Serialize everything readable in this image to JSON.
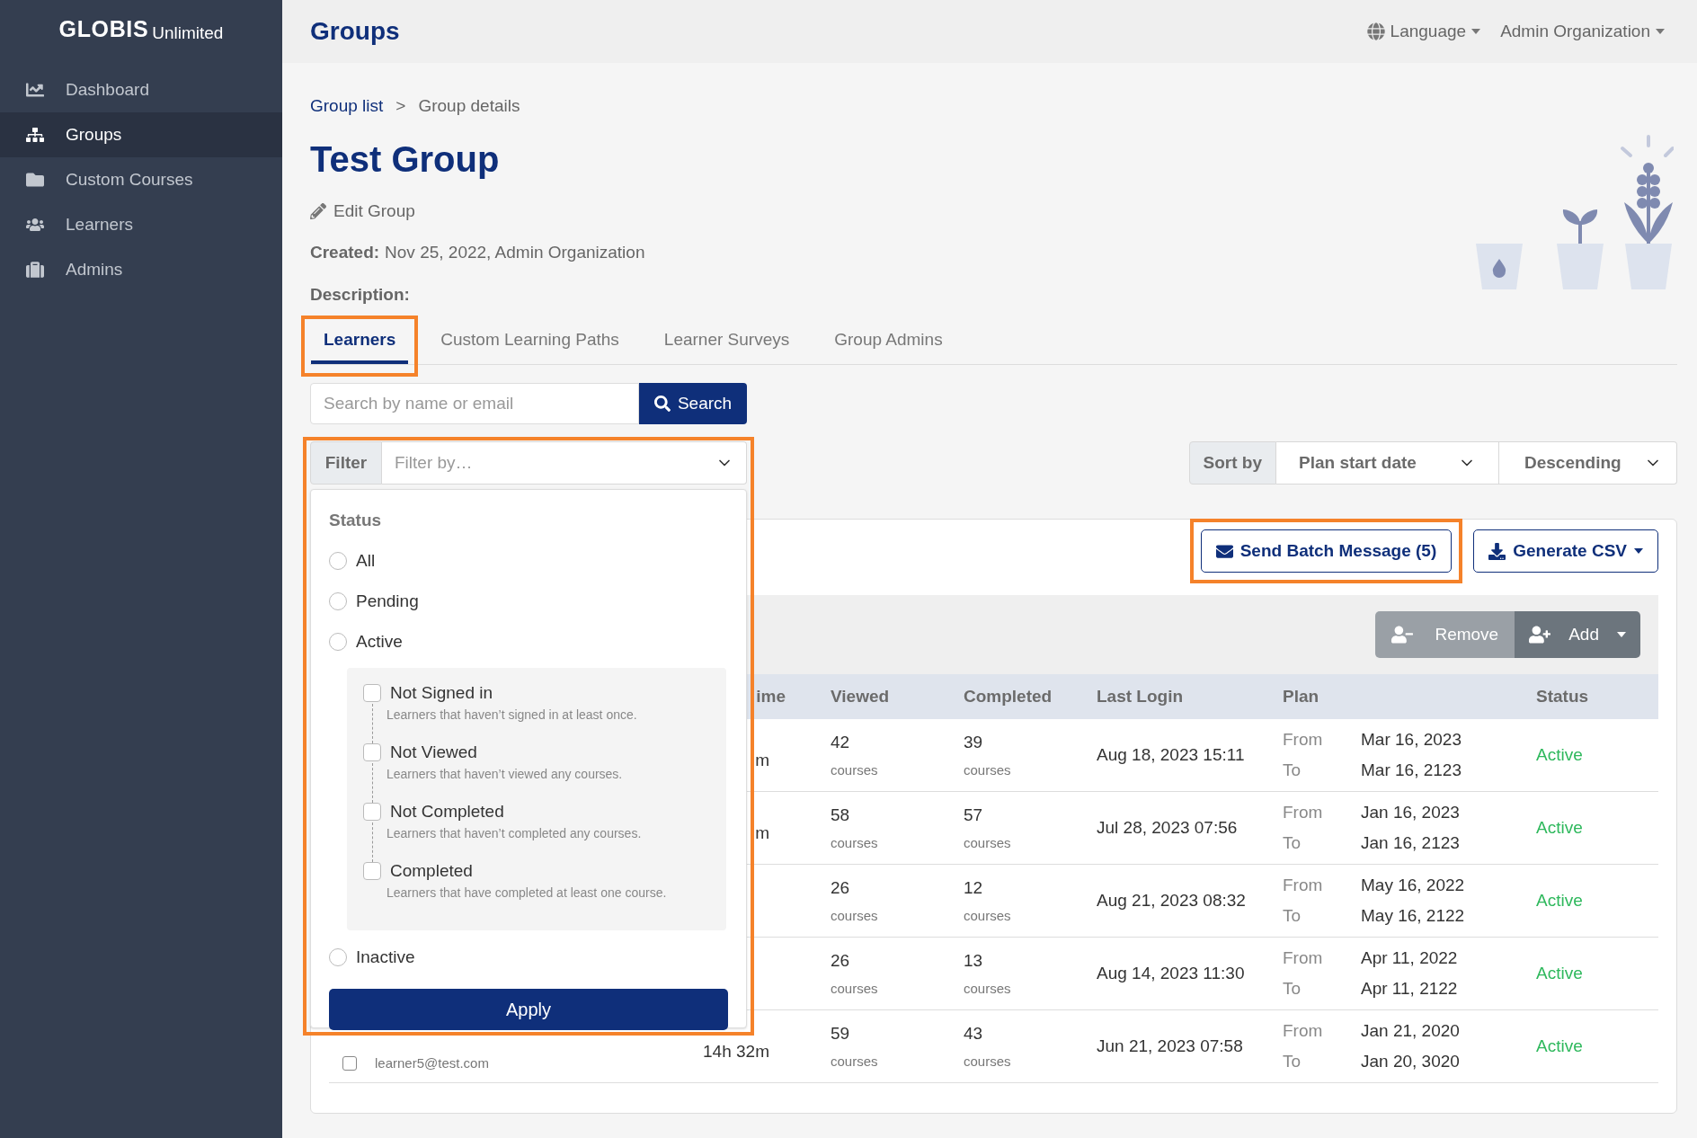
{
  "sidebar": {
    "logo": {
      "brand": "GLOBIS",
      "product": "Unlimited"
    },
    "items": [
      {
        "label": "Dashboard",
        "kind": "chart",
        "selected": false
      },
      {
        "label": "Groups",
        "kind": "groups",
        "selected": true
      },
      {
        "label": "Custom Courses",
        "kind": "folder",
        "selected": false
      },
      {
        "label": "Learners",
        "kind": "people",
        "selected": false
      },
      {
        "label": "Admins",
        "kind": "case",
        "selected": false
      }
    ]
  },
  "header": {
    "title": "Groups",
    "language": "Language",
    "account": "Admin Organization"
  },
  "breadcrumb": [
    {
      "label": "Group list",
      "kind": "link"
    },
    {
      "label": ">",
      "kind": "separator"
    },
    {
      "label": "Group details",
      "kind": "current"
    }
  ],
  "group": {
    "title": "Test Group",
    "edit": "Edit Group",
    "created_label": "Created:",
    "created_value": "Nov 25, 2022, Admin Organization",
    "description_label": "Description:"
  },
  "tabs": [
    {
      "label": "Learners",
      "selected": true,
      "highlighted": true
    },
    {
      "label": "Custom Learning Paths",
      "selected": false,
      "highlighted": false
    },
    {
      "label": "Learner Surveys",
      "selected": false,
      "highlighted": false
    },
    {
      "label": "Group Admins",
      "selected": false,
      "highlighted": false
    }
  ],
  "search": {
    "placeholder": "Search by name or email",
    "button": "Search"
  },
  "filter": {
    "label": "Filter",
    "placeholder": "Filter by…",
    "highlighted": true,
    "menu": {
      "heading": "Status",
      "apply": "Apply",
      "options": [
        {
          "label": "All",
          "selected": false
        },
        {
          "label": "Pending",
          "selected": false
        },
        {
          "label": "Active",
          "selected": false,
          "children": [
            {
              "label": "Not Signed in",
              "description": "Learners that haven’t signed in at least once.",
              "checked": false
            },
            {
              "label": "Not Viewed",
              "description": "Learners that haven’t viewed any courses.",
              "checked": false
            },
            {
              "label": "Not Completed",
              "description": "Learners that haven’t completed any courses.",
              "checked": false
            },
            {
              "label": "Completed",
              "description": "Learners that have completed at least one course.",
              "checked": false
            }
          ]
        },
        {
          "label": "Inactive",
          "selected": false
        }
      ]
    }
  },
  "sort": {
    "label": "Sort by",
    "field": "Plan start date",
    "order": "Descending"
  },
  "actions": {
    "batch": {
      "label": "Send Batch Message (5)",
      "highlighted": true
    },
    "csv": "Generate CSV",
    "remove": "Remove",
    "add": "Add"
  },
  "table": {
    "columns": [
      "ime",
      "Viewed",
      "Completed",
      "Last Login",
      "Plan",
      "Status"
    ],
    "rows": [
      {
        "time": "m",
        "viewed": "42",
        "viewed_unit": "courses",
        "completed": "39",
        "completed_unit": "courses",
        "last_login": "Aug 18, 2023 15:11",
        "from_label": "From",
        "to_label": "To",
        "plan_from": "Mar 16, 2023",
        "plan_to": "Mar 16, 2123",
        "status": "Active"
      },
      {
        "time": "m",
        "viewed": "58",
        "viewed_unit": "courses",
        "completed": "57",
        "completed_unit": "courses",
        "last_login": "Jul 28, 2023 07:56",
        "from_label": "From",
        "to_label": "To",
        "plan_from": "Jan 16, 2023",
        "plan_to": "Jan 16, 2123",
        "status": "Active"
      },
      {
        "viewed": "26",
        "viewed_unit": "courses",
        "completed": "12",
        "completed_unit": "courses",
        "last_login": "Aug 21, 2023 08:32",
        "from_label": "From",
        "to_label": "To",
        "plan_from": "May 16, 2022",
        "plan_to": "May 16, 2122",
        "status": "Active"
      },
      {
        "viewed": "26",
        "viewed_unit": "courses",
        "completed": "13",
        "completed_unit": "courses",
        "last_login": "Aug 14, 2023 11:30",
        "from_label": "From",
        "to_label": "To",
        "plan_from": "Apr 11, 2022",
        "plan_to": "Apr 11, 2122",
        "status": "Active"
      },
      {
        "checked": false,
        "email": "learner5@test.com",
        "time": "14h 32m",
        "viewed": "59",
        "viewed_unit": "courses",
        "completed": "43",
        "completed_unit": "courses",
        "last_login": "Jun 21, 2023 07:58",
        "from_label": "From",
        "to_label": "To",
        "plan_from": "Jan 21, 2020",
        "plan_to": "Jan 20, 3020",
        "status": "Active"
      }
    ]
  }
}
